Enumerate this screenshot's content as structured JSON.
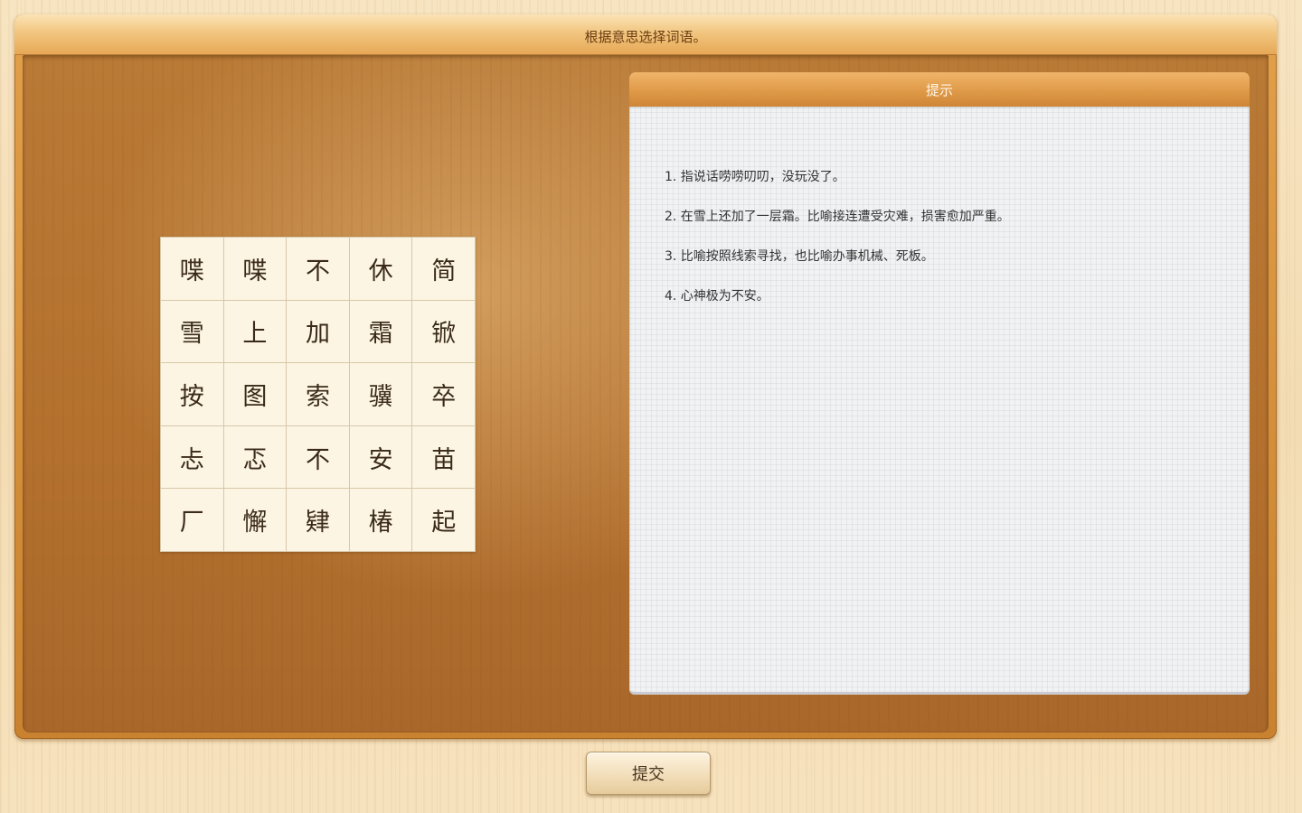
{
  "header": {
    "instruction": "根据意思选择词语。"
  },
  "grid": {
    "cells": [
      "喋",
      "喋",
      "不",
      "休",
      "简",
      "雪",
      "上",
      "加",
      "霜",
      "锨",
      "按",
      "图",
      "索",
      "骥",
      "卒",
      "忐",
      "忑",
      "不",
      "安",
      "苗",
      "厂",
      "懈",
      "肄",
      "椿",
      "起"
    ]
  },
  "hints": {
    "title": "提示",
    "items": [
      "1. 指说话唠唠叨叨，没玩没了。",
      "2. 在雪上还加了一层霜。比喻接连遭受灾难，损害愈加严重。",
      "3. 比喻按照线索寻找，也比喻办事机械、死板。",
      "4. 心神极为不安。"
    ]
  },
  "actions": {
    "submit_label": "提交"
  }
}
